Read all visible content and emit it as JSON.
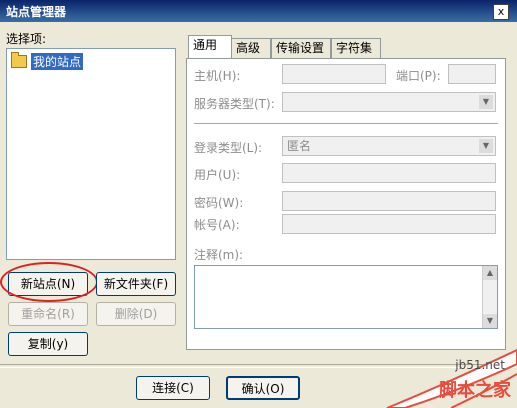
{
  "window": {
    "title": "站点管理器",
    "close_label": "x"
  },
  "left": {
    "choose_label": "选择项:",
    "tree": {
      "root_label": "我的站点"
    },
    "buttons": {
      "new_site": "新站点(N)",
      "new_folder": "新文件夹(F)",
      "rename": "重命名(R)",
      "delete": "删除(D)",
      "copy": "复制(y)"
    }
  },
  "tabs": {
    "items": [
      {
        "label": "通用",
        "active": true
      },
      {
        "label": "高级",
        "active": false
      },
      {
        "label": "传输设置",
        "active": false
      },
      {
        "label": "字符集",
        "active": false
      }
    ]
  },
  "general": {
    "host_label": "主机(H):",
    "port_label": "端口(P):",
    "server_type_label": "服务器类型(T):",
    "login_type_label": "登录类型(L):",
    "login_type_value": "匿名",
    "user_label": "用户(U):",
    "password_label": "密码(W):",
    "account_label": "帐号(A):",
    "notes_label": "注释(m):"
  },
  "footer": {
    "connect": "连接(C)",
    "ok": "确认(O)"
  },
  "watermark": {
    "site": "jb51.net",
    "name": "脚本之家"
  }
}
